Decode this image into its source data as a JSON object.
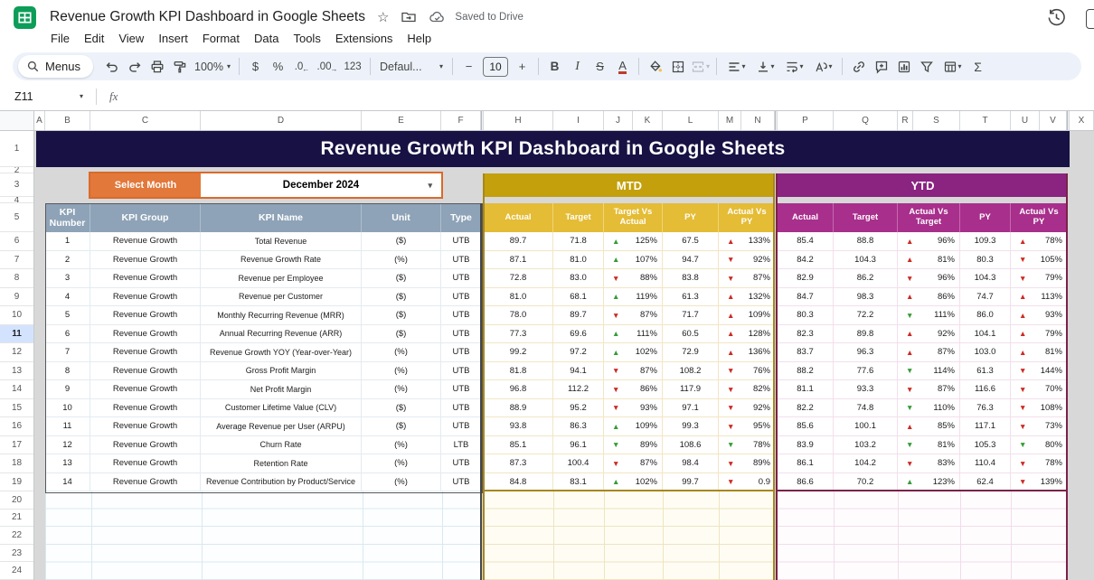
{
  "titlebar": {
    "title": "Revenue Growth KPI Dashboard in Google Sheets",
    "saved_status": "Saved to Drive"
  },
  "menubar": {
    "items": [
      "File",
      "Edit",
      "View",
      "Insert",
      "Format",
      "Data",
      "Tools",
      "Extensions",
      "Help"
    ]
  },
  "toolbar": {
    "menus_label": "Menus",
    "zoom_level": "100%",
    "currency_label": "$",
    "percent_label": "%",
    "decimal_decrease_label": ".0",
    "decimal_increase_label": ".00",
    "number_format_label": "123",
    "font_name": "Defaul...",
    "font_size": "10",
    "minus_label": "−",
    "plus_label": "+",
    "bold_label": "B",
    "italic_label": "I",
    "strikethrough_label": "S",
    "text_color_label": "A",
    "functions_label": "Σ"
  },
  "formula_bar": {
    "name_box": "Z11",
    "fx_label": "fx"
  },
  "grid": {
    "column_labels": [
      "A",
      "B",
      "C",
      "D",
      "E",
      "F",
      "H",
      "I",
      "J",
      "K",
      "L",
      "M",
      "N",
      "P",
      "Q",
      "R",
      "S",
      "T",
      "U",
      "V",
      "X"
    ],
    "row_labels": [
      "1",
      "2",
      "3",
      "4",
      "5",
      "6",
      "7",
      "8",
      "9",
      "10",
      "11",
      "12",
      "13",
      "14",
      "15",
      "16",
      "17",
      "18",
      "19",
      "20",
      "21",
      "22",
      "23",
      "24"
    ],
    "selected_row": "11",
    "selected_cell": "Z11"
  },
  "dashboard": {
    "banner_title": "Revenue Growth KPI Dashboard in Google Sheets",
    "select_month_label": "Select Month",
    "selected_month": "December 2024",
    "mtd_label": "MTD",
    "ytd_label": "YTD",
    "left_headers": [
      "KPI Number",
      "KPI Group",
      "KPI Name",
      "Unit",
      "Type"
    ],
    "mtd_headers": [
      "Actual",
      "Target",
      "Target Vs Actual",
      "PY",
      "Actual Vs PY"
    ],
    "ytd_headers": [
      "Actual",
      "Target",
      "Actual Vs Target",
      "PY",
      "Actual Vs PY"
    ],
    "colors": {
      "banner_navy": "#171243",
      "accent_orange": "#e2783a",
      "mtd_gold": "#c3a00c",
      "mtd_subheader_gold": "#e4bc35",
      "ytd_purple": "#8a2480",
      "ytd_subheader_magenta": "#a82f8c",
      "left_header_blue_gray": "#8ea3b7",
      "up_green": "#379b38",
      "down_red": "#cc2b25"
    },
    "rows": [
      {
        "num": "1",
        "group": "Revenue Growth",
        "name": "Total Revenue",
        "unit": "($)",
        "type": "UTB",
        "mtd": {
          "actual": "89.7",
          "target": "71.8",
          "tva": {
            "dir": "up",
            "color": "green",
            "pct": "125%"
          },
          "py": "67.5",
          "avp": {
            "dir": "up",
            "color": "red",
            "pct": "133%"
          }
        },
        "ytd": {
          "actual": "85.4",
          "target": "88.8",
          "avt": {
            "dir": "up",
            "color": "red",
            "pct": "96%"
          },
          "py": "109.3",
          "avp": {
            "dir": "up",
            "color": "red",
            "pct": "78%"
          }
        }
      },
      {
        "num": "2",
        "group": "Revenue Growth",
        "name": "Revenue Growth Rate",
        "unit": "(%)",
        "type": "UTB",
        "mtd": {
          "actual": "87.1",
          "target": "81.0",
          "tva": {
            "dir": "up",
            "color": "green",
            "pct": "107%"
          },
          "py": "94.7",
          "avp": {
            "dir": "down",
            "color": "red",
            "pct": "92%"
          }
        },
        "ytd": {
          "actual": "84.2",
          "target": "104.3",
          "avt": {
            "dir": "up",
            "color": "red",
            "pct": "81%"
          },
          "py": "80.3",
          "avp": {
            "dir": "down",
            "color": "red",
            "pct": "105%"
          }
        }
      },
      {
        "num": "3",
        "group": "Revenue Growth",
        "name": "Revenue per Employee",
        "unit": "($)",
        "type": "UTB",
        "mtd": {
          "actual": "72.8",
          "target": "83.0",
          "tva": {
            "dir": "down",
            "color": "red",
            "pct": "88%"
          },
          "py": "83.8",
          "avp": {
            "dir": "down",
            "color": "red",
            "pct": "87%"
          }
        },
        "ytd": {
          "actual": "82.9",
          "target": "86.2",
          "avt": {
            "dir": "down",
            "color": "red",
            "pct": "96%"
          },
          "py": "104.3",
          "avp": {
            "dir": "down",
            "color": "red",
            "pct": "79%"
          }
        }
      },
      {
        "num": "4",
        "group": "Revenue Growth",
        "name": "Revenue per Customer",
        "unit": "($)",
        "type": "UTB",
        "mtd": {
          "actual": "81.0",
          "target": "68.1",
          "tva": {
            "dir": "up",
            "color": "green",
            "pct": "119%"
          },
          "py": "61.3",
          "avp": {
            "dir": "up",
            "color": "red",
            "pct": "132%"
          }
        },
        "ytd": {
          "actual": "84.7",
          "target": "98.3",
          "avt": {
            "dir": "up",
            "color": "red",
            "pct": "86%"
          },
          "py": "74.7",
          "avp": {
            "dir": "up",
            "color": "red",
            "pct": "113%"
          }
        }
      },
      {
        "num": "5",
        "group": "Revenue Growth",
        "name": "Monthly Recurring Revenue (MRR)",
        "unit": "($)",
        "type": "UTB",
        "mtd": {
          "actual": "78.0",
          "target": "89.7",
          "tva": {
            "dir": "down",
            "color": "red",
            "pct": "87%"
          },
          "py": "71.7",
          "avp": {
            "dir": "up",
            "color": "red",
            "pct": "109%"
          }
        },
        "ytd": {
          "actual": "80.3",
          "target": "72.2",
          "avt": {
            "dir": "down",
            "color": "green",
            "pct": "111%"
          },
          "py": "86.0",
          "avp": {
            "dir": "up",
            "color": "red",
            "pct": "93%"
          }
        }
      },
      {
        "num": "6",
        "group": "Revenue Growth",
        "name": "Annual Recurring Revenue (ARR)",
        "unit": "($)",
        "type": "UTB",
        "mtd": {
          "actual": "77.3",
          "target": "69.6",
          "tva": {
            "dir": "up",
            "color": "green",
            "pct": "111%"
          },
          "py": "60.5",
          "avp": {
            "dir": "up",
            "color": "red",
            "pct": "128%"
          }
        },
        "ytd": {
          "actual": "82.3",
          "target": "89.8",
          "avt": {
            "dir": "up",
            "color": "red",
            "pct": "92%"
          },
          "py": "104.1",
          "avp": {
            "dir": "up",
            "color": "red",
            "pct": "79%"
          }
        }
      },
      {
        "num": "7",
        "group": "Revenue Growth",
        "name": "Revenue Growth YOY (Year-over-Year)",
        "unit": "(%)",
        "type": "UTB",
        "mtd": {
          "actual": "99.2",
          "target": "97.2",
          "tva": {
            "dir": "up",
            "color": "green",
            "pct": "102%"
          },
          "py": "72.9",
          "avp": {
            "dir": "up",
            "color": "red",
            "pct": "136%"
          }
        },
        "ytd": {
          "actual": "83.7",
          "target": "96.3",
          "avt": {
            "dir": "up",
            "color": "red",
            "pct": "87%"
          },
          "py": "103.0",
          "avp": {
            "dir": "up",
            "color": "red",
            "pct": "81%"
          }
        }
      },
      {
        "num": "8",
        "group": "Revenue Growth",
        "name": "Gross Profit Margin",
        "unit": "(%)",
        "type": "UTB",
        "mtd": {
          "actual": "81.8",
          "target": "94.1",
          "tva": {
            "dir": "down",
            "color": "red",
            "pct": "87%"
          },
          "py": "108.2",
          "avp": {
            "dir": "down",
            "color": "red",
            "pct": "76%"
          }
        },
        "ytd": {
          "actual": "88.2",
          "target": "77.6",
          "avt": {
            "dir": "down",
            "color": "green",
            "pct": "114%"
          },
          "py": "61.3",
          "avp": {
            "dir": "down",
            "color": "red",
            "pct": "144%"
          }
        }
      },
      {
        "num": "9",
        "group": "Revenue Growth",
        "name": "Net Profit Margin",
        "unit": "(%)",
        "type": "UTB",
        "mtd": {
          "actual": "96.8",
          "target": "112.2",
          "tva": {
            "dir": "down",
            "color": "red",
            "pct": "86%"
          },
          "py": "117.9",
          "avp": {
            "dir": "down",
            "color": "red",
            "pct": "82%"
          }
        },
        "ytd": {
          "actual": "81.1",
          "target": "93.3",
          "avt": {
            "dir": "down",
            "color": "red",
            "pct": "87%"
          },
          "py": "116.6",
          "avp": {
            "dir": "down",
            "color": "red",
            "pct": "70%"
          }
        }
      },
      {
        "num": "10",
        "group": "Revenue Growth",
        "name": "Customer Lifetime Value (CLV)",
        "unit": "($)",
        "type": "UTB",
        "mtd": {
          "actual": "88.9",
          "target": "95.2",
          "tva": {
            "dir": "down",
            "color": "red",
            "pct": "93%"
          },
          "py": "97.1",
          "avp": {
            "dir": "down",
            "color": "red",
            "pct": "92%"
          }
        },
        "ytd": {
          "actual": "82.2",
          "target": "74.8",
          "avt": {
            "dir": "down",
            "color": "green",
            "pct": "110%"
          },
          "py": "76.3",
          "avp": {
            "dir": "down",
            "color": "red",
            "pct": "108%"
          }
        }
      },
      {
        "num": "11",
        "group": "Revenue Growth",
        "name": "Average Revenue per User (ARPU)",
        "unit": "($)",
        "type": "UTB",
        "mtd": {
          "actual": "93.8",
          "target": "86.3",
          "tva": {
            "dir": "up",
            "color": "green",
            "pct": "109%"
          },
          "py": "99.3",
          "avp": {
            "dir": "down",
            "color": "red",
            "pct": "95%"
          }
        },
        "ytd": {
          "actual": "85.6",
          "target": "100.1",
          "avt": {
            "dir": "up",
            "color": "red",
            "pct": "85%"
          },
          "py": "117.1",
          "avp": {
            "dir": "down",
            "color": "red",
            "pct": "73%"
          }
        }
      },
      {
        "num": "12",
        "group": "Revenue Growth",
        "name": "Churn Rate",
        "unit": "(%)",
        "type": "LTB",
        "mtd": {
          "actual": "85.1",
          "target": "96.1",
          "tva": {
            "dir": "down",
            "color": "green",
            "pct": "89%"
          },
          "py": "108.6",
          "avp": {
            "dir": "down",
            "color": "green",
            "pct": "78%"
          }
        },
        "ytd": {
          "actual": "83.9",
          "target": "103.2",
          "avt": {
            "dir": "down",
            "color": "green",
            "pct": "81%"
          },
          "py": "105.3",
          "avp": {
            "dir": "down",
            "color": "green",
            "pct": "80%"
          }
        }
      },
      {
        "num": "13",
        "group": "Revenue Growth",
        "name": "Retention Rate",
        "unit": "(%)",
        "type": "UTB",
        "mtd": {
          "actual": "87.3",
          "target": "100.4",
          "tva": {
            "dir": "down",
            "color": "red",
            "pct": "87%"
          },
          "py": "98.4",
          "avp": {
            "dir": "down",
            "color": "red",
            "pct": "89%"
          }
        },
        "ytd": {
          "actual": "86.1",
          "target": "104.2",
          "avt": {
            "dir": "down",
            "color": "red",
            "pct": "83%"
          },
          "py": "110.4",
          "avp": {
            "dir": "down",
            "color": "red",
            "pct": "78%"
          }
        }
      },
      {
        "num": "14",
        "group": "Revenue Growth",
        "name": "Revenue Contribution by Product/Service",
        "unit": "(%)",
        "type": "UTB",
        "mtd": {
          "actual": "84.8",
          "target": "83.1",
          "tva": {
            "dir": "up",
            "color": "green",
            "pct": "102%"
          },
          "py": "99.7",
          "avp": {
            "dir": "down",
            "color": "red",
            "pct": "0.9"
          }
        },
        "ytd": {
          "actual": "86.6",
          "target": "70.2",
          "avt": {
            "dir": "up",
            "color": "green",
            "pct": "123%"
          },
          "py": "62.4",
          "avp": {
            "dir": "down",
            "color": "red",
            "pct": "139%"
          }
        }
      }
    ]
  }
}
